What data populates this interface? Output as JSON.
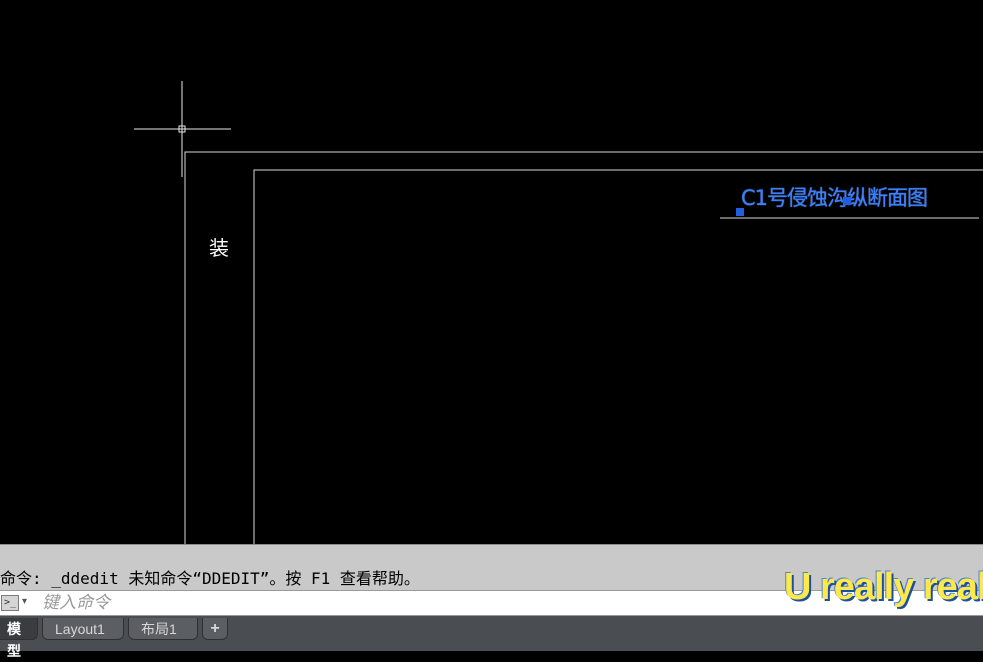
{
  "canvas": {
    "background": "#000000",
    "binding_margin_label": "装",
    "drawing_title": "C1号侵蚀沟纵断面图",
    "title_color": "#3b7fff",
    "grip_color": "#1f5fe0"
  },
  "command_line": {
    "history": "命令: _ddedit 未知命令“DDEDIT”。按 F1 查看帮助。",
    "input_placeholder": "键入命令",
    "icon": "command-prompt-icon",
    "dropdown_icon": "chevron-down-icon"
  },
  "watermark": {
    "text": "U really real"
  },
  "tabs": [
    {
      "label": "模型",
      "active": true
    },
    {
      "label": "Layout1",
      "active": false
    },
    {
      "label": "布局1",
      "active": false
    },
    {
      "label": "+",
      "active": false
    }
  ]
}
